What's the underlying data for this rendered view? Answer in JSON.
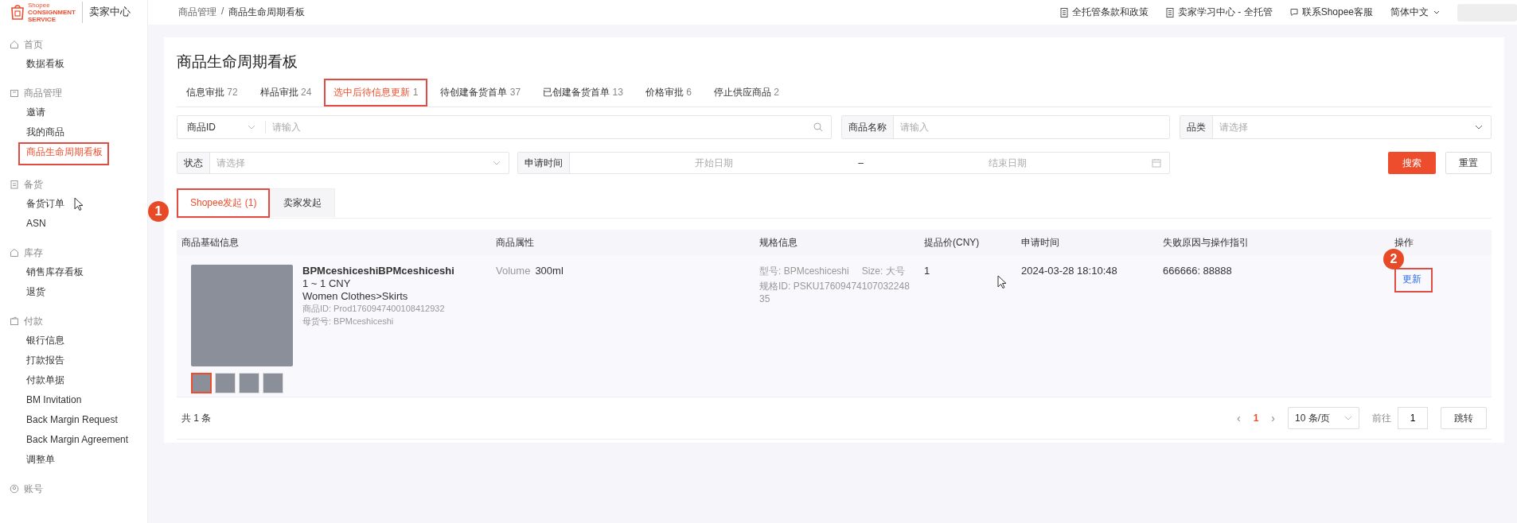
{
  "header": {
    "logo": {
      "brand_small": "Shopee",
      "brand_line1": "CONSIGNMENT",
      "brand_line2": "SERVICE"
    },
    "portal_title": "卖家中心",
    "breadcrumb": [
      "商品管理",
      "商品生命周期看板"
    ],
    "breadcrumb_separator": "/",
    "links": [
      "全托管条款和政策",
      "卖家学习中心 - 全托管",
      "联系Shopee客服"
    ],
    "language": "简体中文"
  },
  "sidebar": {
    "groups": [
      {
        "label": "首页",
        "items": [
          {
            "label": "数据看板",
            "selected": false,
            "highlighted": false
          }
        ]
      },
      {
        "label": "商品管理",
        "items": [
          {
            "label": "邀请",
            "selected": false,
            "highlighted": false
          },
          {
            "label": "我的商品",
            "selected": false,
            "highlighted": false
          },
          {
            "label": "商品生命周期看板",
            "selected": true,
            "highlighted": true
          }
        ]
      },
      {
        "label": "备货",
        "items": [
          {
            "label": "备货订单",
            "selected": false,
            "highlighted": false
          },
          {
            "label": "ASN",
            "selected": false,
            "highlighted": false
          }
        ]
      },
      {
        "label": "库存",
        "items": [
          {
            "label": "销售库存看板",
            "selected": false,
            "highlighted": false
          },
          {
            "label": "退货",
            "selected": false,
            "highlighted": false
          }
        ]
      },
      {
        "label": "付款",
        "items": [
          {
            "label": "银行信息",
            "selected": false,
            "highlighted": false
          },
          {
            "label": "打款报告",
            "selected": false,
            "highlighted": false
          },
          {
            "label": "付款单据",
            "selected": false,
            "highlighted": false
          },
          {
            "label": "BM Invitation",
            "selected": false,
            "highlighted": false
          },
          {
            "label": "Back Margin Request",
            "selected": false,
            "highlighted": false
          },
          {
            "label": "Back Margin Agreement",
            "selected": false,
            "highlighted": false
          },
          {
            "label": "调整单",
            "selected": false,
            "highlighted": false
          }
        ]
      },
      {
        "label": "账号"
      }
    ]
  },
  "page": {
    "title": "商品生命周期看板",
    "tabs": [
      {
        "label": "信息审批",
        "count": "72",
        "selected": false,
        "highlighted": false
      },
      {
        "label": "样品审批",
        "count": "24",
        "selected": false,
        "highlighted": false
      },
      {
        "label": "选中后待信息更新",
        "count": "1",
        "selected": true,
        "highlighted": true
      },
      {
        "label": "待创建备货首单",
        "count": "37",
        "selected": false,
        "highlighted": false
      },
      {
        "label": "已创建备货首单",
        "count": "13",
        "selected": false,
        "highlighted": false
      },
      {
        "label": "价格审批",
        "count": "6",
        "selected": false,
        "highlighted": false
      },
      {
        "label": "停止供应商品",
        "count": "2",
        "selected": false,
        "highlighted": false
      }
    ],
    "filters": {
      "id_type": "商品ID",
      "id_placeholder": "请输入",
      "name_label": "商品名称",
      "name_placeholder": "请输入",
      "category_label": "品类",
      "category_placeholder": "请选择",
      "status_label": "状态",
      "status_placeholder": "请选择",
      "date_label": "申请时间",
      "date_start": "开始日期",
      "date_separator": "–",
      "date_end": "结束日期",
      "search_button": "搜索",
      "reset_button": "重置"
    },
    "subtabs": [
      {
        "label": "Shopee发起 (1)",
        "selected": true,
        "highlighted": true,
        "callout": "1"
      },
      {
        "label": "卖家发起",
        "selected": false,
        "highlighted": false
      }
    ],
    "table": {
      "columns": [
        "商品基础信息",
        "商品属性",
        "规格信息",
        "提品价(CNY)",
        "申请时间",
        "失败原因与操作指引",
        "操作"
      ],
      "rows": [
        {
          "thumbnails": [
            {
              "selected": true
            },
            {
              "selected": false
            },
            {
              "selected": false
            },
            {
              "selected": false
            }
          ],
          "name": "BPMceshiceshiBPMceshiceshi",
          "price_range": "1 ~ 1 CNY",
          "category": "Women Clothes>Skirts",
          "product_id": "商品ID: Prod1760947400108412932",
          "parent_sku": "母货号: BPMceshiceshi",
          "attribute_name": "Volume",
          "attribute_value": "300ml",
          "spec_model": "型号: BPMceshiceshi",
          "spec_size": "Size: 大号",
          "spec_id": "规格ID: PSKU1760947410703224835",
          "price": "1",
          "time": "2024-03-28 18:10:48",
          "reason": "666666: 88888",
          "action": "更新",
          "action_highlighted": true,
          "action_callout": "2"
        }
      ]
    },
    "footer": {
      "total": "共 1 条",
      "prev": "‹",
      "pages": [
        {
          "label": "1",
          "selected": true
        }
      ],
      "next": "›",
      "page_size": "10 条/页",
      "goto_label": "前往",
      "goto_value": "1",
      "jump_button": "跳转"
    }
  }
}
